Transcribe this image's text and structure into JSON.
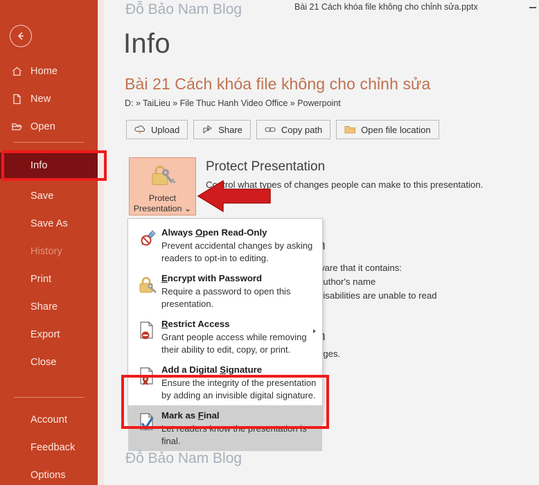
{
  "window": {
    "document_title": "Bài 21 Cách khóa file không cho chỉnh sửa.pptx",
    "minimize_label": "minimize"
  },
  "watermark": {
    "top": "Đỗ Bảo Nam Blog",
    "bottom": "Đỗ Bảo Nam Blog"
  },
  "sidebar": {
    "back_label": "Back",
    "items": [
      {
        "label": "Home",
        "icon": "home-icon"
      },
      {
        "label": "New",
        "icon": "new-document-icon"
      },
      {
        "label": "Open",
        "icon": "open-folder-icon"
      },
      {
        "label": "Info",
        "icon": "none"
      },
      {
        "label": "Save",
        "icon": "none"
      },
      {
        "label": "Save As",
        "icon": "none"
      },
      {
        "label": "History",
        "icon": "none"
      },
      {
        "label": "Print",
        "icon": "none"
      },
      {
        "label": "Share",
        "icon": "none"
      },
      {
        "label": "Export",
        "icon": "none"
      },
      {
        "label": "Close",
        "icon": "none"
      },
      {
        "label": "Account",
        "icon": "none"
      },
      {
        "label": "Feedback",
        "icon": "none"
      },
      {
        "label": "Options",
        "icon": "none"
      }
    ],
    "selected": "Info",
    "disabled": "History"
  },
  "main": {
    "page_title": "Info",
    "file_title": "Bài 21 Cách khóa file không cho chỉnh sửa",
    "file_path": "D: » TaiLieu » File Thuc Hanh Video Office » Powerpoint",
    "toolbar": [
      {
        "label": "Upload",
        "icon": "cloud-upload-icon"
      },
      {
        "label": "Share",
        "icon": "share-arrow-icon"
      },
      {
        "label": "Copy path",
        "icon": "link-icon"
      },
      {
        "label": "Open file location",
        "icon": "folder-icon"
      }
    ],
    "protect": {
      "tile_line1": "Protect",
      "tile_line2": "Presentation",
      "tile_chevron": "⌄",
      "heading": "Protect Presentation",
      "description": "Control what types of changes people can make to this presentation.",
      "icon": "lock-key-icon"
    },
    "inspect": {
      "heading_visible_fragment": "n",
      "lines": [
        "ware that it contains:",
        "author's name",
        "disabilities are unable to read"
      ]
    },
    "version_history": {
      "heading_visible_fragment": "n",
      "line": "nges."
    }
  },
  "menu": {
    "items": [
      {
        "title_pre": "Always ",
        "title_accel": "O",
        "title_post": "pen Read-Only",
        "desc_line1": "Prevent accidental changes by asking",
        "desc_line2": "readers to opt-in to editing.",
        "icon": "pencil-blocked-icon",
        "has_submenu": false,
        "highlighted": false
      },
      {
        "title_pre": "",
        "title_accel": "E",
        "title_post": "ncrypt with Password",
        "desc_line1": "Require a password to open this",
        "desc_line2": "presentation.",
        "icon": "padlock-key-icon",
        "has_submenu": false,
        "highlighted": false
      },
      {
        "title_pre": "",
        "title_accel": "R",
        "title_post": "estrict Access",
        "desc_line1": "Grant people access while removing",
        "desc_line2": "their ability to edit, copy, or print.",
        "icon": "document-restricted-icon",
        "has_submenu": true,
        "highlighted": false
      },
      {
        "title_pre": "Add a Digital ",
        "title_accel": "S",
        "title_post": "ignature",
        "desc_line1": "Ensure the integrity of the presentation",
        "desc_line2": "by adding an invisible digital signature.",
        "icon": "document-seal-icon",
        "has_submenu": false,
        "highlighted": false
      },
      {
        "title_pre": "Mark as ",
        "title_accel": "F",
        "title_post": "inal",
        "desc_line1": "Let readers know the presentation is",
        "desc_line2": "final.",
        "icon": "document-check-icon",
        "has_submenu": false,
        "highlighted": true
      }
    ]
  },
  "annotations": {
    "highlight_color": "#ee1c1c",
    "boxes": [
      "info-sidebar-item",
      "mark-as-final-menu-item"
    ],
    "arrow": "arrow-pointing-to-protect-presentation"
  },
  "colors": {
    "sidebar_bg": "#c44123",
    "sidebar_selected_bg": "#7b1113",
    "content_bg": "#f3f3f3",
    "accent_title": "#c0714f",
    "protect_tile_bg": "#f7c3ab",
    "annotation_red": "#ee1c1c"
  }
}
